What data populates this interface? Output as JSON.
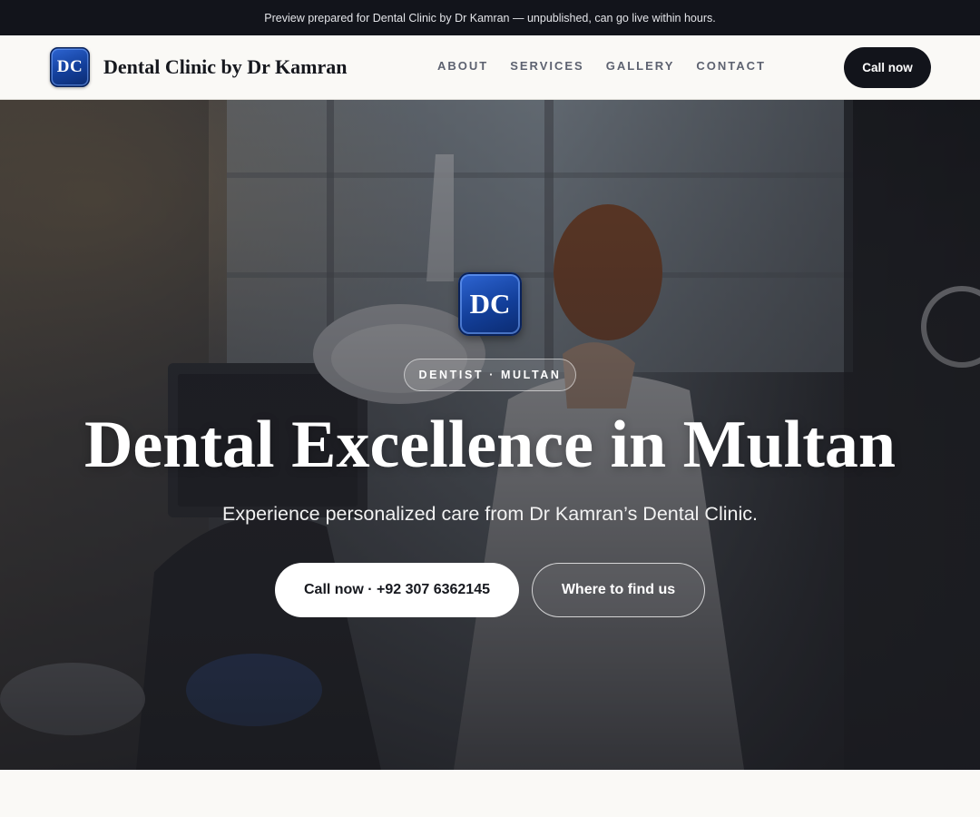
{
  "preview_banner": "Preview prepared for Dental Clinic by Dr Kamran — unpublished, can go live within hours.",
  "brand": {
    "monogram": "DC",
    "name": "Dental Clinic by Dr Kamran",
    "color": "#1a4fb5"
  },
  "nav": {
    "items": [
      {
        "label": "ABOUT"
      },
      {
        "label": "SERVICES"
      },
      {
        "label": "GALLERY"
      },
      {
        "label": "CONTACT"
      }
    ],
    "cta_label": "Call now"
  },
  "hero": {
    "monogram": "DC",
    "eyebrow": "DENTIST · MULTAN",
    "title": "Dental Excellence in Multan",
    "subtitle": "Experience personalized care from Dr Kamran’s Dental Clinic.",
    "primary_cta": "Call now · +92 307 6362145",
    "secondary_cta": "Where to find us",
    "background_image": "dentist-treating-patient-photo"
  },
  "colors": {
    "dark": "#12141b",
    "page_bg": "#faf9f6",
    "accent_blue": "#1a4fb5"
  }
}
